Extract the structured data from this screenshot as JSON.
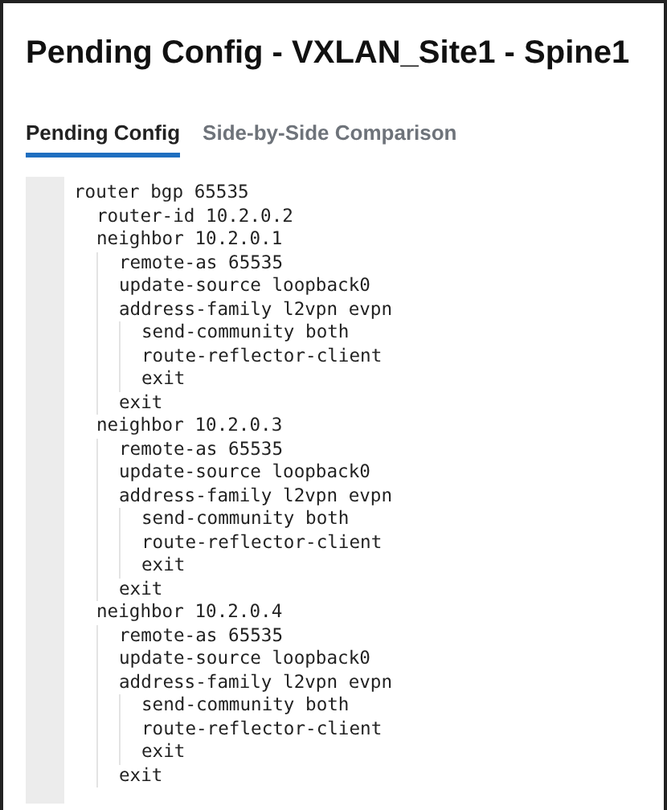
{
  "title": "Pending Config - VXLAN_Site1 - Spine1",
  "tabs": [
    {
      "label": "Pending Config",
      "selected": true
    },
    {
      "label": "Side-by-Side Comparison",
      "selected": false
    }
  ],
  "config": [
    {
      "text": "router bgp 65535",
      "children": [
        {
          "text": "router-id 10.2.0.2"
        },
        {
          "text": "neighbor 10.2.0.1",
          "children": [
            {
              "text": "remote-as 65535"
            },
            {
              "text": "update-source loopback0"
            },
            {
              "text": "address-family l2vpn evpn",
              "children": [
                {
                  "text": "send-community both"
                },
                {
                  "text": "route-reflector-client"
                },
                {
                  "text": "exit"
                }
              ]
            },
            {
              "text": "exit"
            }
          ]
        },
        {
          "text": "neighbor 10.2.0.3",
          "children": [
            {
              "text": "remote-as 65535"
            },
            {
              "text": "update-source loopback0"
            },
            {
              "text": "address-family l2vpn evpn",
              "children": [
                {
                  "text": "send-community both"
                },
                {
                  "text": "route-reflector-client"
                },
                {
                  "text": "exit"
                }
              ]
            },
            {
              "text": "exit"
            }
          ]
        },
        {
          "text": "neighbor 10.2.0.4",
          "children": [
            {
              "text": "remote-as 65535"
            },
            {
              "text": "update-source loopback0"
            },
            {
              "text": "address-family l2vpn evpn",
              "children": [
                {
                  "text": "send-community both"
                },
                {
                  "text": "route-reflector-client"
                },
                {
                  "text": "exit"
                }
              ]
            },
            {
              "text": "exit"
            }
          ]
        }
      ]
    }
  ]
}
